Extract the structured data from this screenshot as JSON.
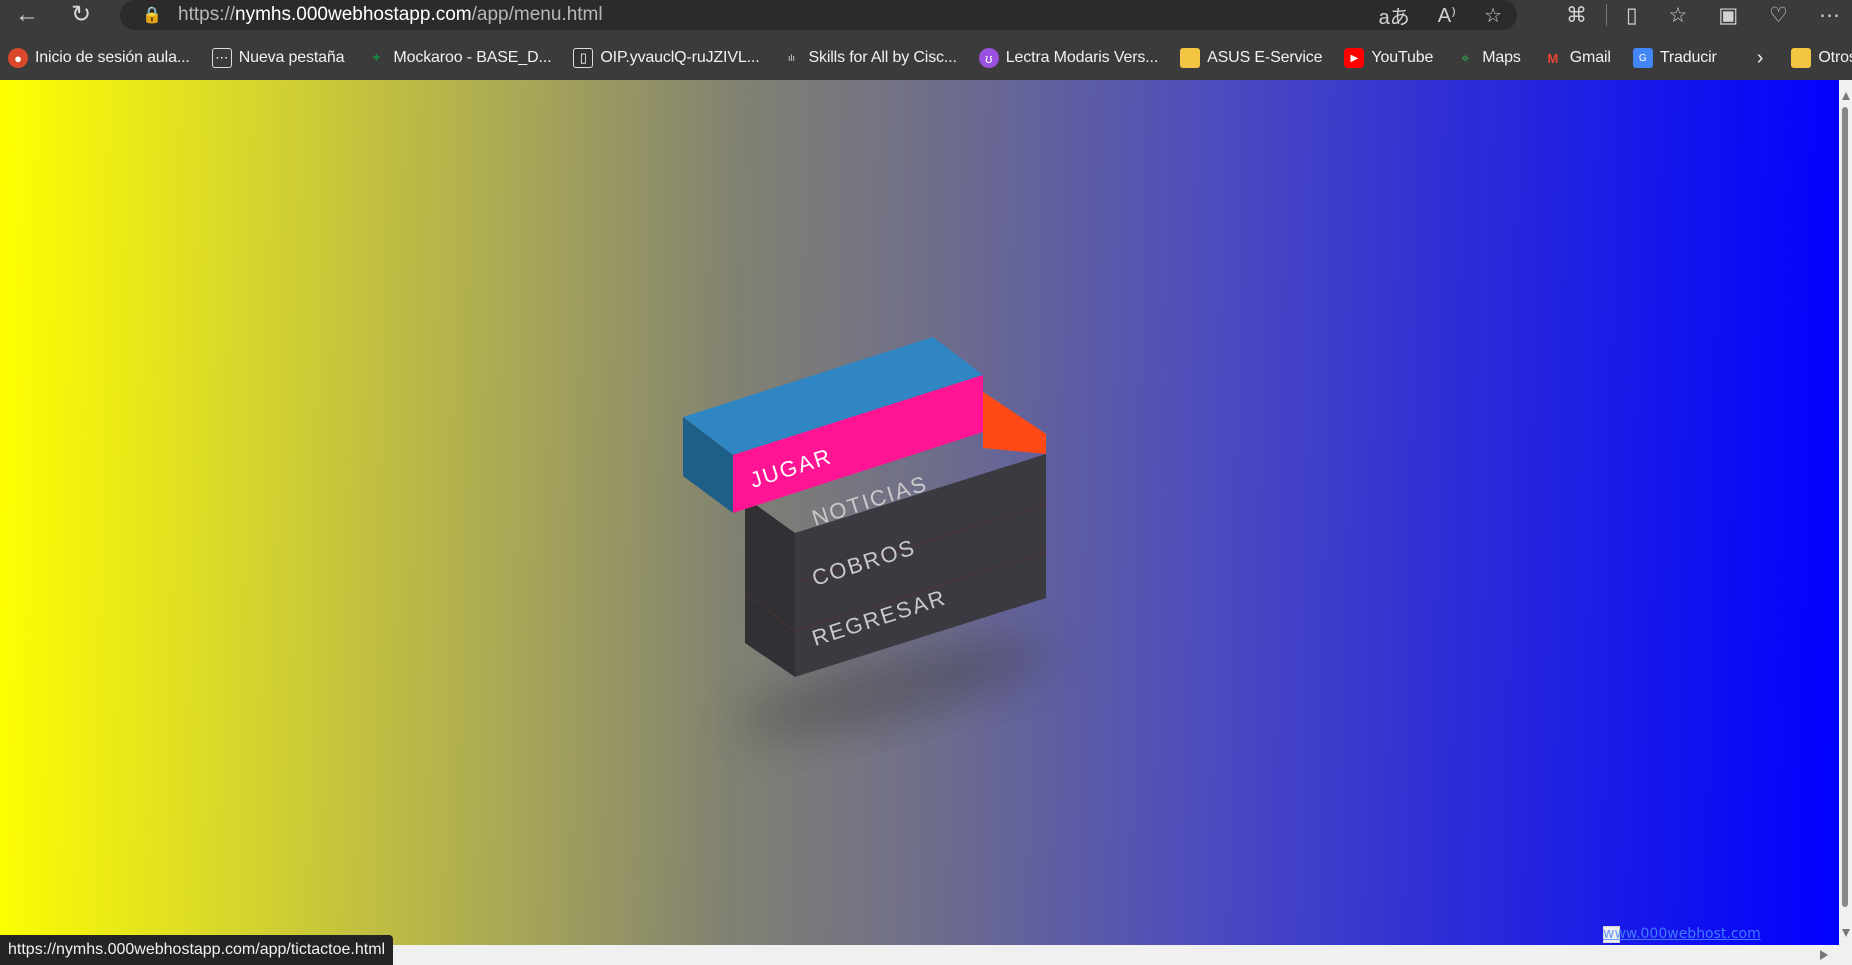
{
  "browser": {
    "url": {
      "scheme": "https://",
      "host": "nymhs.000webhostapp.com",
      "path": "/app/menu.html"
    },
    "status_url": "https://nymhs.000webhostapp.com/app/tictactoe.html",
    "bookmarks": [
      {
        "label": "Inicio de sesión aula...",
        "icon": "moodle-icon",
        "color": "#e04b2a"
      },
      {
        "label": "Nueva pestaña",
        "icon": "new-tab-icon",
        "color": "#3b3b3b"
      },
      {
        "label": "Mockaroo - BASE_D...",
        "icon": "mockaroo-icon",
        "color": "#0c7b32"
      },
      {
        "label": "OIP.yvauclQ-ruJZIVL...",
        "icon": "file-icon",
        "color": "#3b3b3b"
      },
      {
        "label": "Skills for All by Cisc...",
        "icon": "cisco-icon",
        "color": "#3b3b3b"
      },
      {
        "label": "Lectra Modaris Vers...",
        "icon": "lectra-icon",
        "color": "#9b51e0"
      },
      {
        "label": "ASUS E-Service",
        "icon": "folder-icon",
        "color": "#f4c542"
      },
      {
        "label": "YouTube",
        "icon": "youtube-icon",
        "color": "#ff0000"
      },
      {
        "label": "Maps",
        "icon": "maps-icon",
        "color": "#34a853"
      },
      {
        "label": "Gmail",
        "icon": "gmail-icon",
        "color": "#ea4335"
      },
      {
        "label": "Traducir",
        "icon": "translate-icon",
        "color": "#4285f4"
      }
    ],
    "other_favorites": "Otros favoritos"
  },
  "menu": {
    "items": [
      {
        "label": "JUGAR",
        "active": true
      },
      {
        "label": "NOTICIAS",
        "active": false
      },
      {
        "label": "COBROS",
        "active": false
      },
      {
        "label": "REGRESAR",
        "active": false
      }
    ],
    "colors": {
      "active_front": "#ff1493",
      "active_top": "#2f86c3",
      "active_side": "#1e5f87",
      "accent_side": "#ff4a16",
      "body_front": "#3b3a40",
      "body_side": "#303035",
      "label": "#c9c9c9",
      "active_label": "#ffffff"
    }
  },
  "watermark": "www.000webhost.com"
}
